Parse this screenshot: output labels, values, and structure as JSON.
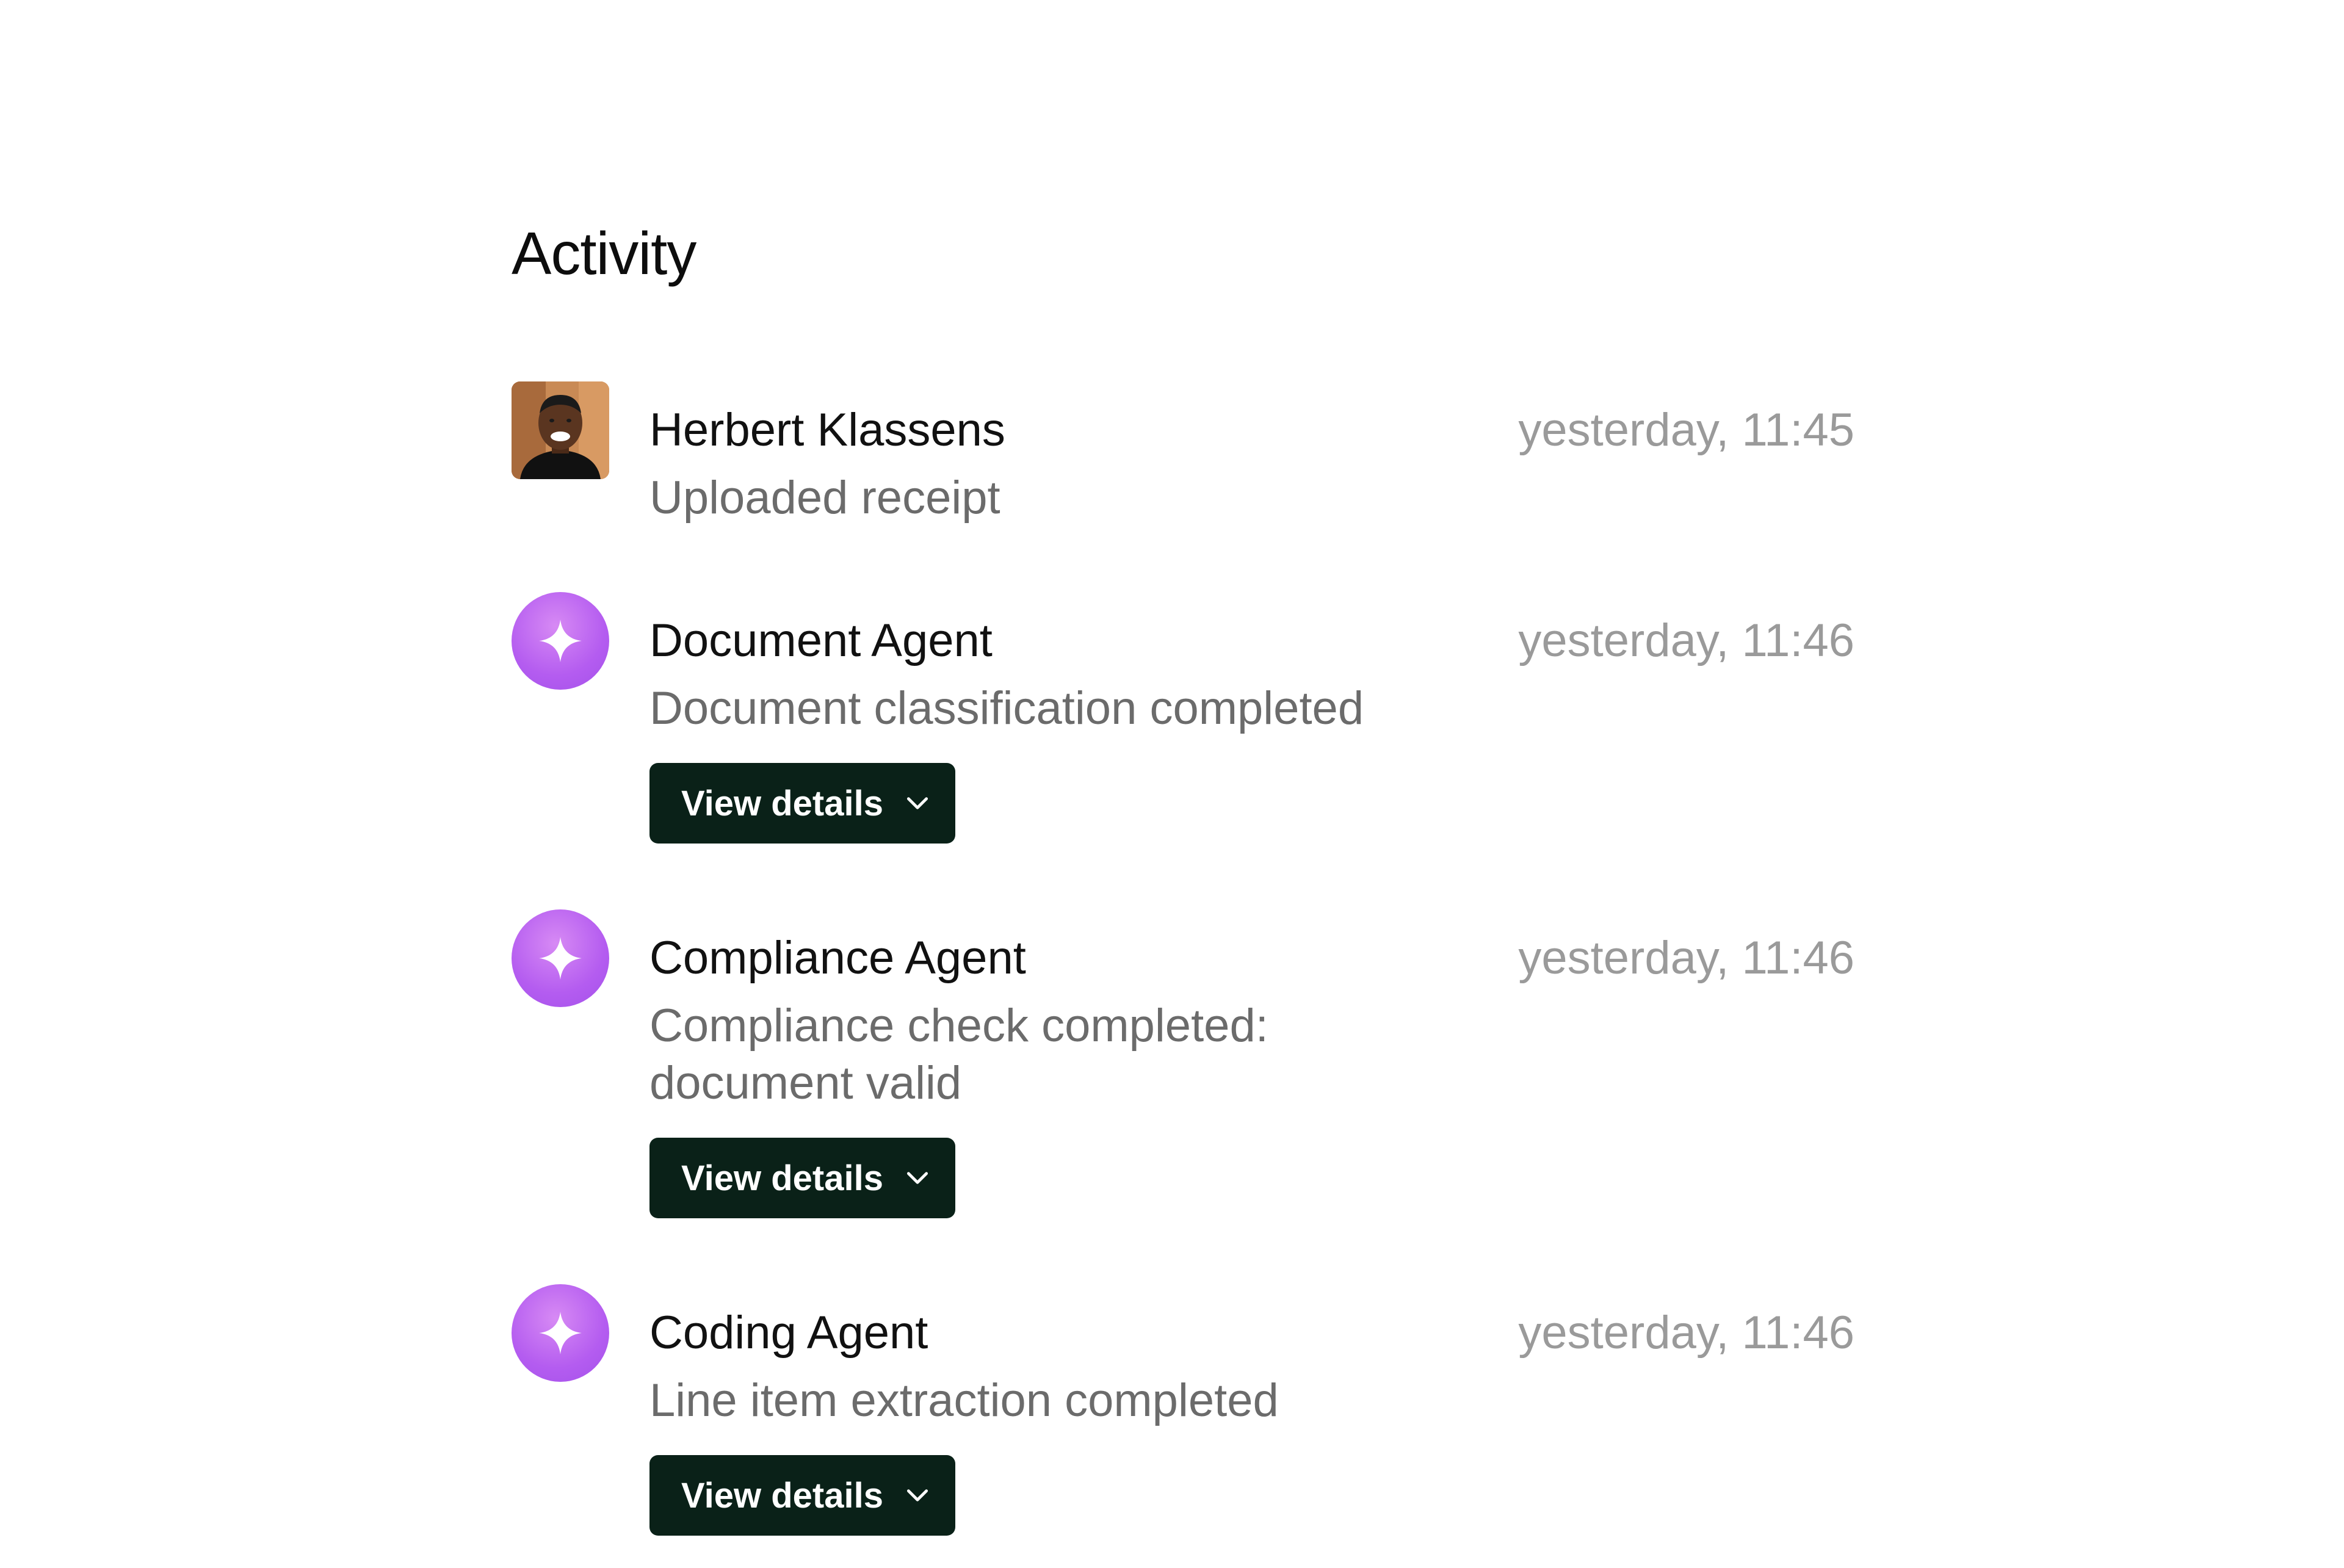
{
  "title": "Activity",
  "items": [
    {
      "name": "Herbert Klassens",
      "description": "Uploaded receipt",
      "time": "yesterday, 11:45",
      "avatar": "user-photo"
    },
    {
      "name": "Document Agent",
      "description": "Document classification completed",
      "time": "yesterday, 11:46",
      "avatar": "sparkle-icon",
      "button": "View details"
    },
    {
      "name": "Compliance Agent",
      "description": "Compliance check completed: document valid",
      "time": "yesterday, 11:46",
      "avatar": "sparkle-icon",
      "button": "View details"
    },
    {
      "name": "Coding Agent",
      "description": "Line item extraction completed",
      "time": "yesterday, 11:46",
      "avatar": "sparkle-icon",
      "button": "View details"
    }
  ],
  "colors": {
    "button_bg": "#0a2118",
    "agent_avatar": "#b45cf0",
    "secondary_text": "#6b6b6b",
    "timestamp_text": "#9a9a9a"
  }
}
